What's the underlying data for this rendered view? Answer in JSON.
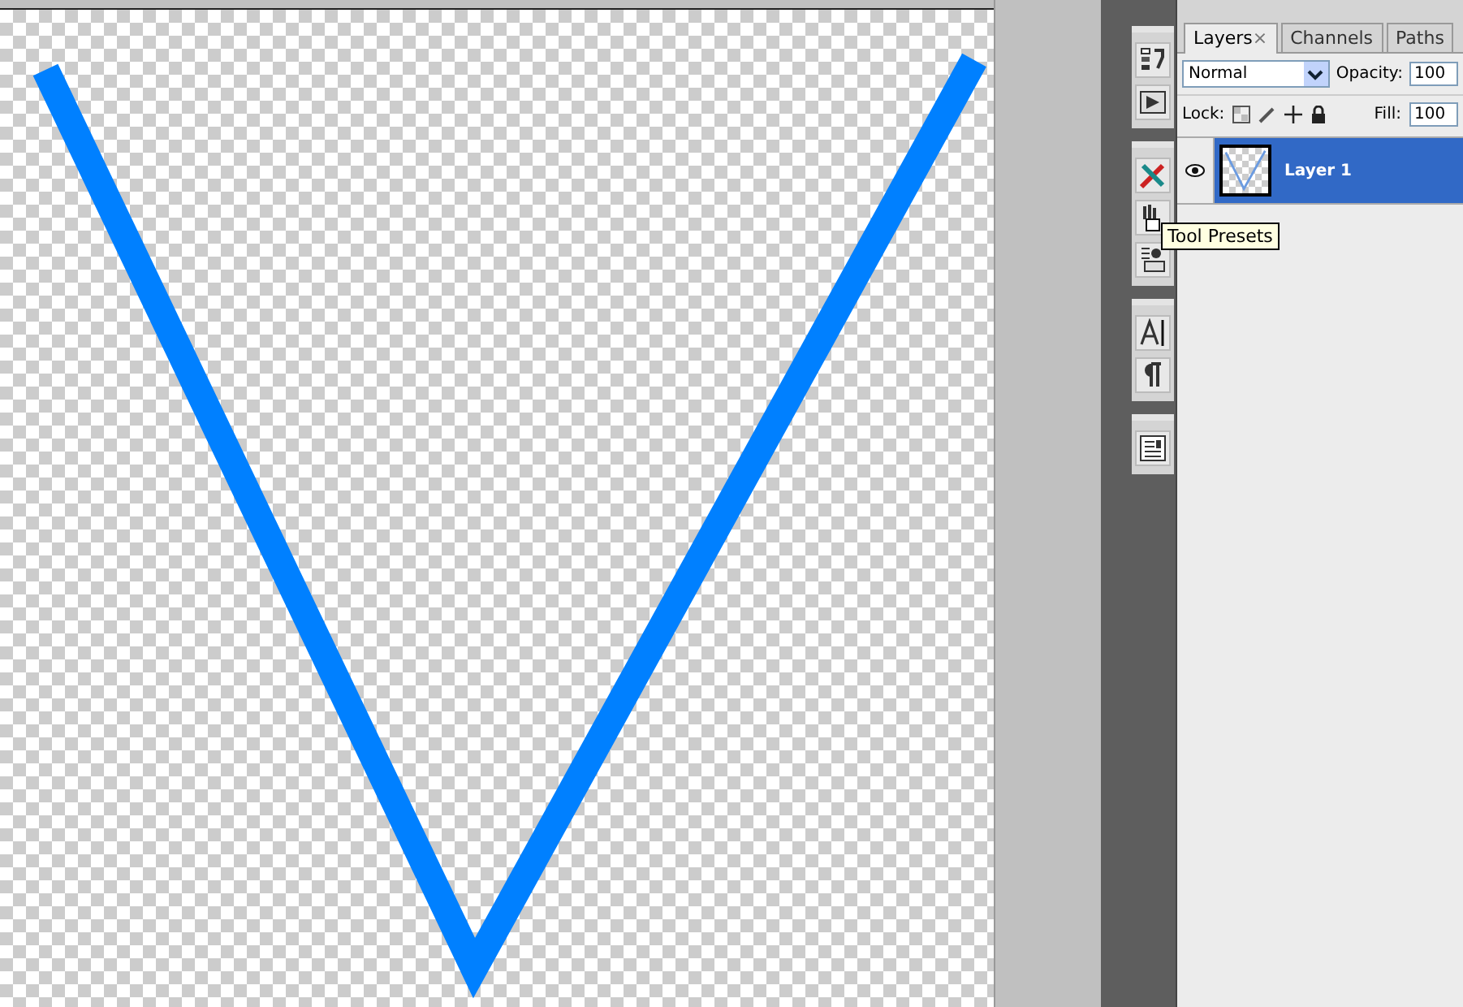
{
  "tabs": [
    {
      "label": "Layers",
      "close": "×",
      "selected": true
    },
    {
      "label": "Channels",
      "selected": false
    },
    {
      "label": "Paths",
      "selected": false
    }
  ],
  "blend_mode": {
    "value": "Normal"
  },
  "opacity": {
    "label": "Opacity:",
    "value": "100"
  },
  "lock": {
    "label": "Lock:"
  },
  "fill": {
    "label": "Fill:",
    "value": "100"
  },
  "layers": [
    {
      "name": "Layer 1",
      "visible": true,
      "selected": true
    }
  ],
  "tooltip": {
    "text": "Tool Presets"
  }
}
